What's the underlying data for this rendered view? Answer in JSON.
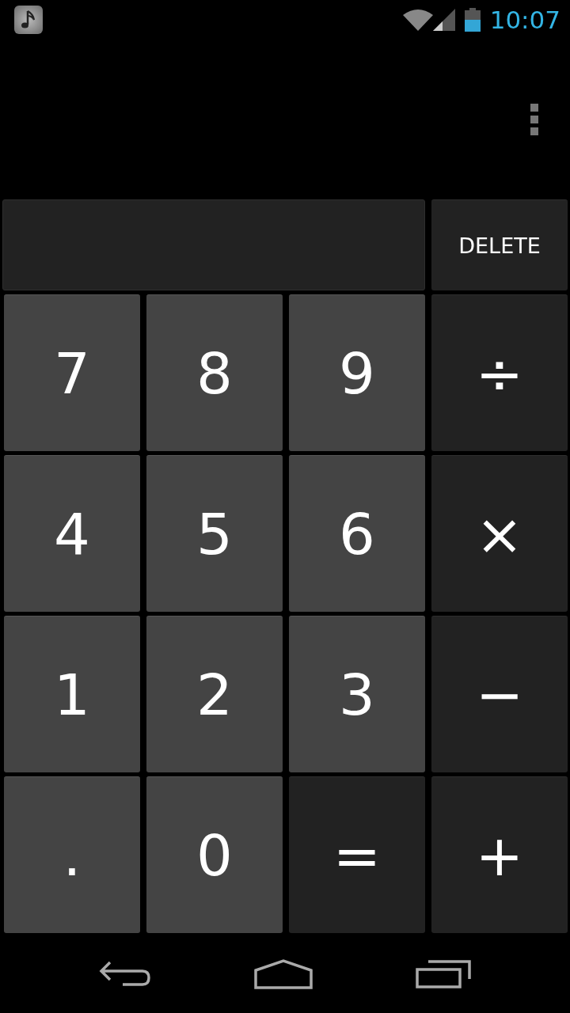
{
  "status_bar": {
    "time": "10:07"
  },
  "display": {
    "delete_button": "DELETE"
  },
  "keypad": [
    {
      "label": "7",
      "kind": "digit"
    },
    {
      "label": "8",
      "kind": "digit"
    },
    {
      "label": "9",
      "kind": "digit"
    },
    {
      "label": "÷",
      "kind": "operator"
    },
    {
      "label": "4",
      "kind": "digit"
    },
    {
      "label": "5",
      "kind": "digit"
    },
    {
      "label": "6",
      "kind": "digit"
    },
    {
      "label": "×",
      "kind": "operator"
    },
    {
      "label": "1",
      "kind": "digit"
    },
    {
      "label": "2",
      "kind": "digit"
    },
    {
      "label": "3",
      "kind": "digit"
    },
    {
      "label": "−",
      "kind": "operator"
    },
    {
      "label": ".",
      "kind": "digit"
    },
    {
      "label": "0",
      "kind": "digit"
    },
    {
      "label": "=",
      "kind": "operator"
    },
    {
      "label": "+",
      "kind": "operator"
    }
  ]
}
